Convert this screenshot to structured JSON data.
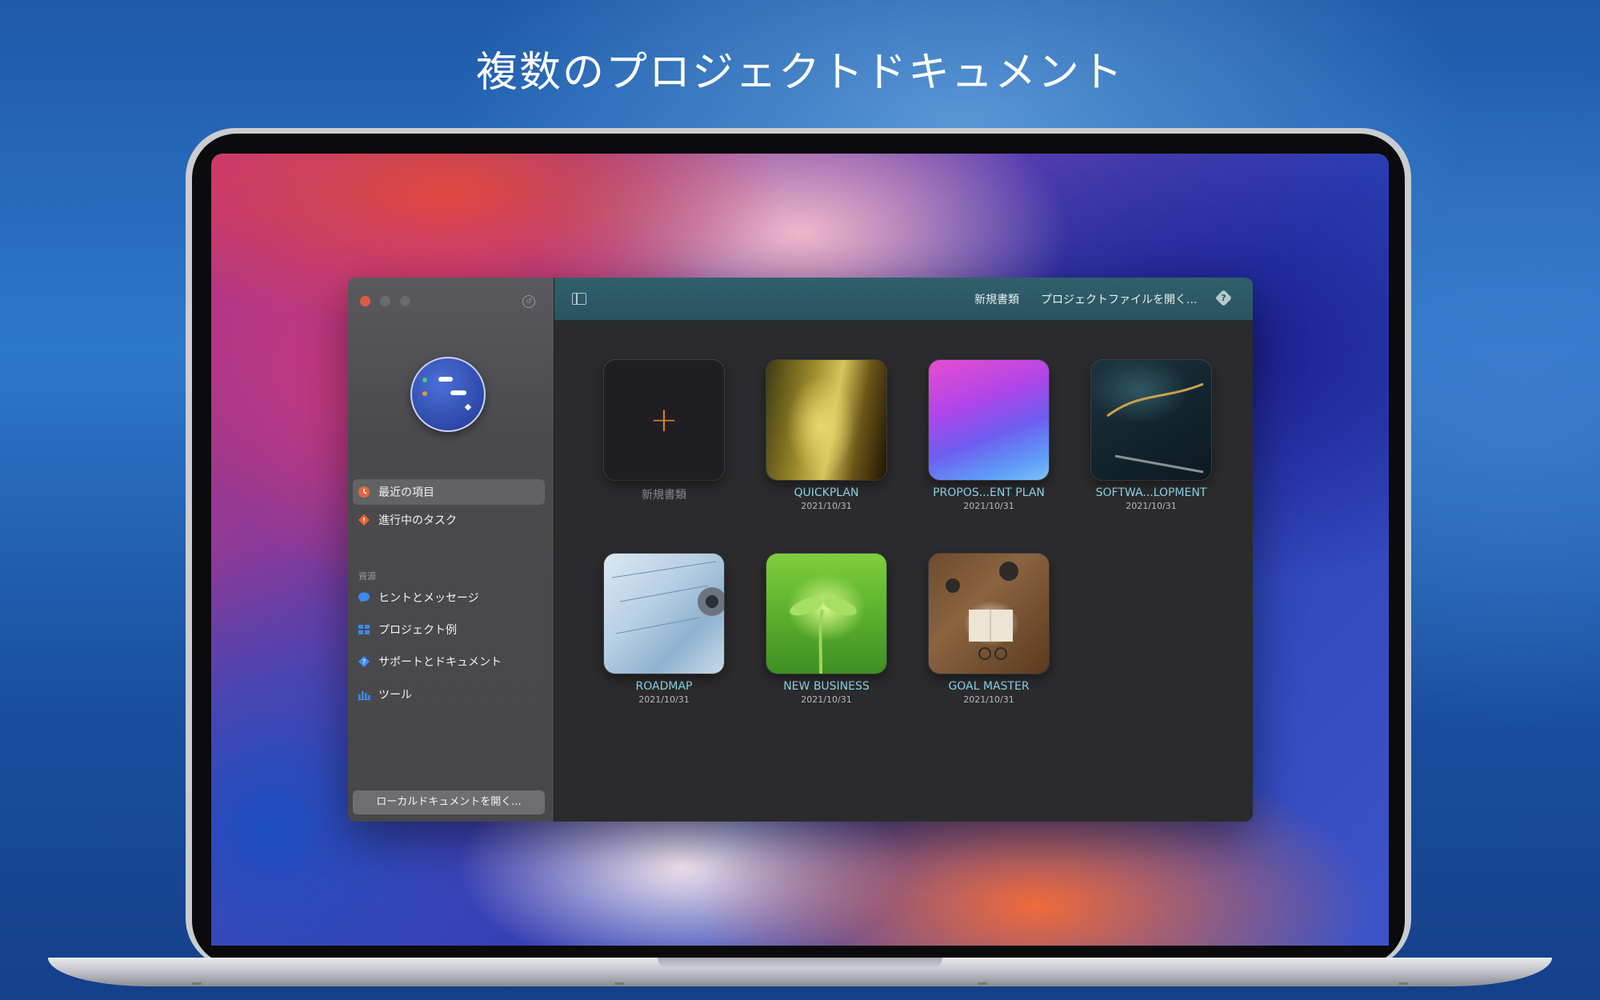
{
  "headline": "複数のプロジェクトドキュメント",
  "colors": {
    "accent_orange": "#d9822f",
    "toolbar_teal": "#2f5d6a",
    "tile_title": "#8fd8ee",
    "close": "#e15a47"
  },
  "sidebar": {
    "items": [
      {
        "label": "最近の項目",
        "icon": "clock-icon",
        "selected": true
      },
      {
        "label": "進行中のタスク",
        "icon": "diamond-task-icon",
        "selected": false
      }
    ],
    "resources_label": "資源",
    "resources": [
      {
        "label": "ヒントとメッセージ",
        "icon": "chat-bubble-icon"
      },
      {
        "label": "プロジェクト例",
        "icon": "grid-icon"
      },
      {
        "label": "サポートとドキュメント",
        "icon": "help-diamond-icon"
      },
      {
        "label": "ツール",
        "icon": "bar-chart-icon"
      }
    ],
    "open_local_label": "ローカルドキュメントを開く..."
  },
  "toolbar": {
    "new_doc_label": "新規書類",
    "open_project_label": "プロジェクトファイルを開く...",
    "help_symbol": "?"
  },
  "documents": [
    {
      "title": "新規書類",
      "date": "",
      "thumb": "new",
      "plus": "+"
    },
    {
      "title": "QUICKPLAN",
      "date": "2021/10/31",
      "thumb": "quick"
    },
    {
      "title": "PROPOS...ENT PLAN",
      "date": "2021/10/31",
      "thumb": "propos"
    },
    {
      "title": "SOFTWA...LOPMENT",
      "date": "2021/10/31",
      "thumb": "soft"
    },
    {
      "title": "ROADMAP",
      "date": "2021/10/31",
      "thumb": "road"
    },
    {
      "title": "NEW BUSINESS",
      "date": "2021/10/31",
      "thumb": "biz"
    },
    {
      "title": "GOAL MASTER",
      "date": "2021/10/31",
      "thumb": "goal"
    }
  ]
}
